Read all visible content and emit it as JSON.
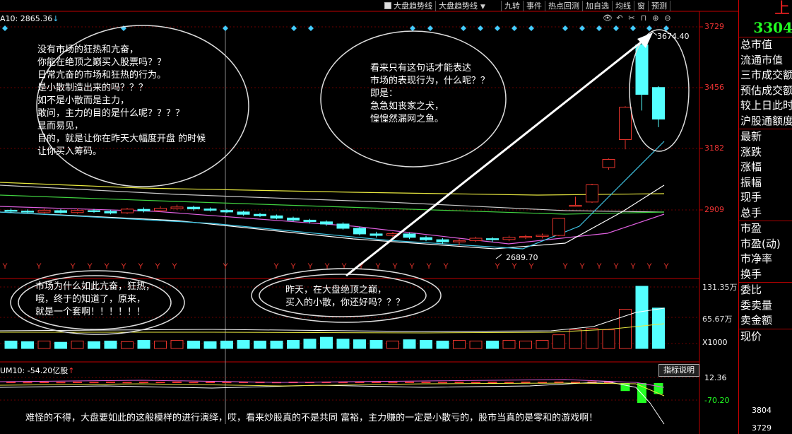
{
  "toolbar": {
    "items": [
      {
        "label": "大盘趋势线",
        "type": "checkbox"
      },
      {
        "label": "大盘趋势线",
        "type": "dropdown"
      },
      {
        "label": "九转"
      },
      {
        "label": "事件"
      },
      {
        "label": "热点回测"
      },
      {
        "label": "加自选"
      },
      {
        "label": "均线"
      },
      {
        "label": "窗"
      },
      {
        "label": "预测"
      }
    ],
    "icons": [
      "eye-icon",
      "undo-icon",
      "scissors-icon",
      "lock-icon",
      "zoom-in-icon",
      "zoom-out-icon"
    ]
  },
  "ma_label": "A10: 2865.36",
  "price_axis": [
    "3729",
    "3456",
    "3182",
    "2909"
  ],
  "price_high_label": "3674.40",
  "price_low_label": "2689.70",
  "volume_axis": [
    "131.35万",
    "65.67万"
  ],
  "volume_unit": "X1000",
  "indicator": {
    "label": "UM10: -54.20亿股",
    "up_arrow": "↑",
    "button": "指标说明",
    "axis": [
      "12.36",
      "-70.20"
    ]
  },
  "annotations": {
    "left": "没有市场的狂热和亢奋，\n你能在绝顶之巅买入股票吗？？\n日常亢奋的市场和狂热的行为。\n是小散制造出来的吗？？？\n如不是小散而是主力，\n敢问，主力的目的是什么呢？？？？\n显而易见，\n目的，就是让你在昨天大幅度开盘 的时候\n让你买入筹码。",
    "middle": "看来只有这句话才能表达\n市场的表现行为，什么呢？？\n即是：\n急急如丧家之犬，\n惶惶然漏网之鱼。",
    "vol_left": "市场为什么如此亢奋，狂热，\n哦，终于的知道了，原来，\n就是一个套啊！！！！！！",
    "vol_mid": "昨天，在大盘绝顶之巅，\n买入的小散，你还好吗？？？",
    "bottom": "难怪的不得，大盘要如此的这般模样的进行演绎，哎，看来炒股真的不是共同 富裕，主力赚的一定是小散亏的，股市当真的是零和的游戏啊！"
  },
  "right_panel": {
    "title": "上",
    "index_value": "3304",
    "group1": [
      "总市值",
      "流通市值",
      "三市成交额",
      "预估成交额",
      "较上日此时",
      "沪股通额度"
    ],
    "group2": [
      "最新",
      "涨跌",
      "涨幅",
      "振幅",
      "现手",
      "总手"
    ],
    "group3": [
      "市盈",
      "市盈(动)",
      "市净率",
      "换手"
    ],
    "group4": [
      "委比",
      "委卖量",
      "卖金额"
    ],
    "group5": [
      "现价"
    ],
    "bottom_values": [
      "3804",
      "3729"
    ]
  },
  "y_marker": "Y",
  "colors": {
    "up": "#e8342c",
    "down": "#54ffff",
    "axis": "#c00000",
    "ma_white": "#ffffff",
    "ma_yellow": "#e8e840",
    "ma_green": "#40d040",
    "ma_magenta": "#e060e0"
  },
  "chart_data": {
    "type": "candlestick",
    "price_ylim": [
      2689.7,
      3674.4
    ],
    "candles": [
      {
        "o": 2882,
        "c": 2878,
        "h": 2890,
        "l": 2870
      },
      {
        "o": 2878,
        "c": 2874,
        "h": 2886,
        "l": 2868
      },
      {
        "o": 2873,
        "c": 2882,
        "h": 2889,
        "l": 2868
      },
      {
        "o": 2880,
        "c": 2872,
        "h": 2887,
        "l": 2866
      },
      {
        "o": 2871,
        "c": 2881,
        "h": 2890,
        "l": 2866
      },
      {
        "o": 2880,
        "c": 2876,
        "h": 2888,
        "l": 2870
      },
      {
        "o": 2877,
        "c": 2869,
        "h": 2884,
        "l": 2863
      },
      {
        "o": 2870,
        "c": 2887,
        "h": 2893,
        "l": 2865
      },
      {
        "o": 2886,
        "c": 2879,
        "h": 2895,
        "l": 2872
      },
      {
        "o": 2880,
        "c": 2891,
        "h": 2900,
        "l": 2875
      },
      {
        "o": 2889,
        "c": 2897,
        "h": 2908,
        "l": 2884
      },
      {
        "o": 2896,
        "c": 2888,
        "h": 2903,
        "l": 2880
      },
      {
        "o": 2888,
        "c": 2882,
        "h": 2895,
        "l": 2876
      },
      {
        "o": 2881,
        "c": 2874,
        "h": 2888,
        "l": 2868
      },
      {
        "o": 2874,
        "c": 2863,
        "h": 2880,
        "l": 2857
      },
      {
        "o": 2863,
        "c": 2856,
        "h": 2870,
        "l": 2850
      },
      {
        "o": 2856,
        "c": 2845,
        "h": 2862,
        "l": 2840
      },
      {
        "o": 2846,
        "c": 2836,
        "h": 2852,
        "l": 2830
      },
      {
        "o": 2836,
        "c": 2829,
        "h": 2842,
        "l": 2820
      },
      {
        "o": 2828,
        "c": 2818,
        "h": 2835,
        "l": 2810
      },
      {
        "o": 2818,
        "c": 2798,
        "h": 2826,
        "l": 2792
      },
      {
        "o": 2798,
        "c": 2772,
        "h": 2806,
        "l": 2765
      },
      {
        "o": 2772,
        "c": 2765,
        "h": 2782,
        "l": 2755
      },
      {
        "o": 2765,
        "c": 2773,
        "h": 2781,
        "l": 2758
      },
      {
        "o": 2772,
        "c": 2756,
        "h": 2778,
        "l": 2748
      },
      {
        "o": 2755,
        "c": 2745,
        "h": 2763,
        "l": 2738
      },
      {
        "o": 2745,
        "c": 2735,
        "h": 2752,
        "l": 2725
      },
      {
        "o": 2735,
        "c": 2740,
        "h": 2749,
        "l": 2718
      },
      {
        "o": 2741,
        "c": 2752,
        "h": 2759,
        "l": 2735
      },
      {
        "o": 2750,
        "c": 2746,
        "h": 2757,
        "l": 2734
      },
      {
        "o": 2746,
        "c": 2756,
        "h": 2764,
        "l": 2738
      },
      {
        "o": 2755,
        "c": 2760,
        "h": 2768,
        "l": 2748
      },
      {
        "o": 2760,
        "c": 2766,
        "h": 2774,
        "l": 2751
      },
      {
        "o": 2765,
        "c": 2844,
        "h": 2846,
        "l": 2761
      },
      {
        "o": 2900,
        "c": 2905,
        "h": 2945,
        "l": 2898
      },
      {
        "o": 2920,
        "c": 3000,
        "h": 3005,
        "l": 2916
      },
      {
        "o": 3080,
        "c": 3118,
        "h": 3122,
        "l": 3070
      },
      {
        "o": 3210,
        "c": 3360,
        "h": 3365,
        "l": 3165
      },
      {
        "o": 3650,
        "c": 3420,
        "h": 3674,
        "l": 3345
      },
      {
        "o": 3452,
        "c": 3305,
        "h": 3458,
        "l": 3268
      }
    ],
    "volumes": [
      0.12,
      0.11,
      0.12,
      0.1,
      0.12,
      0.11,
      0.12,
      0.11,
      0.13,
      0.12,
      0.13,
      0.12,
      0.11,
      0.12,
      0.13,
      0.12,
      0.12,
      0.13,
      0.15,
      0.18,
      0.15,
      0.14,
      0.13,
      0.12,
      0.14,
      0.13,
      0.12,
      0.13,
      0.12,
      0.12,
      0.13,
      0.12,
      0.13,
      0.22,
      0.3,
      0.32,
      0.3,
      0.63,
      1.0,
      0.65
    ],
    "indicator_values": [
      0.3,
      0.25,
      0.28,
      0.26,
      0.3,
      0.27,
      0.31,
      0.26,
      0.3,
      0.28,
      0.32,
      0.26,
      0.3,
      0.27,
      0.29,
      0.31,
      0.26,
      0.3,
      0.28,
      0.3,
      0.27,
      0.3,
      0.28,
      0.26,
      0.3,
      0.29,
      0.27,
      0.3,
      0.28,
      0.3,
      0.26,
      0.31,
      0.28,
      0.32,
      0.3,
      0.35,
      0.34,
      -0.4,
      -1.0,
      -0.55
    ]
  }
}
